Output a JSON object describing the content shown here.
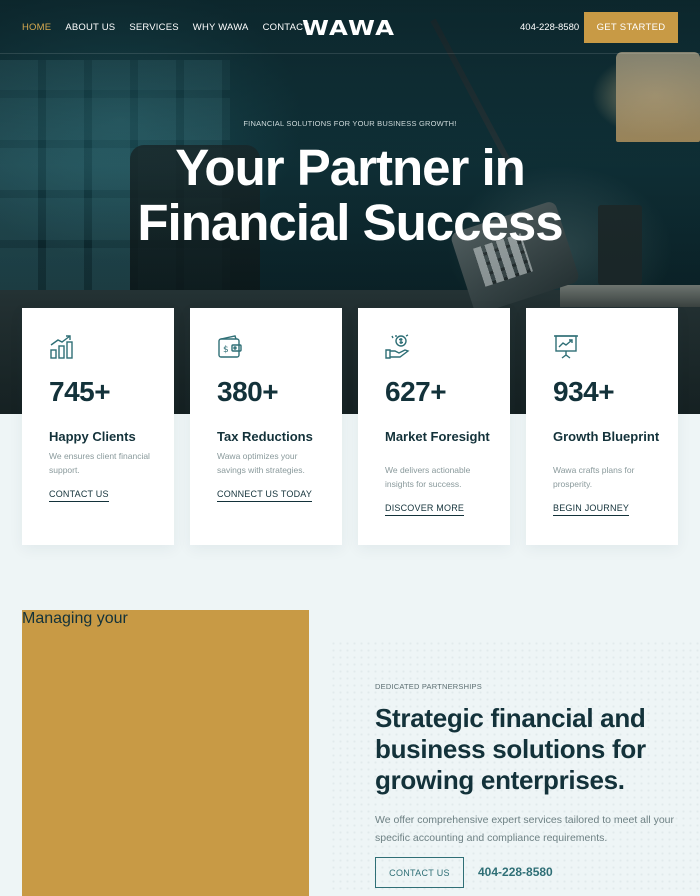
{
  "nav": {
    "links": [
      "HOME",
      "ABOUT US",
      "SERVICES",
      "WHY WAWA",
      "CONTACT"
    ],
    "logo": "WAWA",
    "phone": "404-228-8580",
    "cta": "GET STARTED",
    "active_color": "#d6a84f"
  },
  "hero": {
    "eyebrow": "FINANCIAL SOLUTIONS FOR YOUR BUSINESS GROWTH!",
    "title_line1": "Your Partner in",
    "title_line2": "Financial Success"
  },
  "stats": [
    {
      "icon": "bar-chart-icon",
      "number": "745+",
      "title": "Happy Clients",
      "desc": "We ensures client financial support.",
      "link": "CONTACT US"
    },
    {
      "icon": "wallet-icon",
      "number": "380+",
      "title": "Tax Reductions",
      "desc": "Wawa optimizes your savings with strategies.",
      "link": "CONNECT US TODAY"
    },
    {
      "icon": "money-hand-icon",
      "number": "627+",
      "title": "Market Foresight",
      "desc": "We delivers actionable insights for success.",
      "link": "DISCOVER MORE"
    },
    {
      "icon": "presentation-icon",
      "number": "934+",
      "title": "Growth Blueprint",
      "desc": "Wawa crafts plans for prosperity.",
      "link": "BEGIN JOURNEY"
    }
  ],
  "section2": {
    "eyebrow": "DEDICATED PARTNERSHIPS",
    "title": "Strategic financial and business solutions for growing enterprises.",
    "desc": "We offer comprehensive expert services tailored to meet all your specific accounting and compliance requirements.",
    "button": "CONTACT US",
    "phone": "404-228-8580",
    "photo_label": "Managing your"
  },
  "colors": {
    "gold": "#c89a45",
    "teal": "#2f6f76",
    "dark": "#13323a",
    "background": "#eef5f6"
  }
}
